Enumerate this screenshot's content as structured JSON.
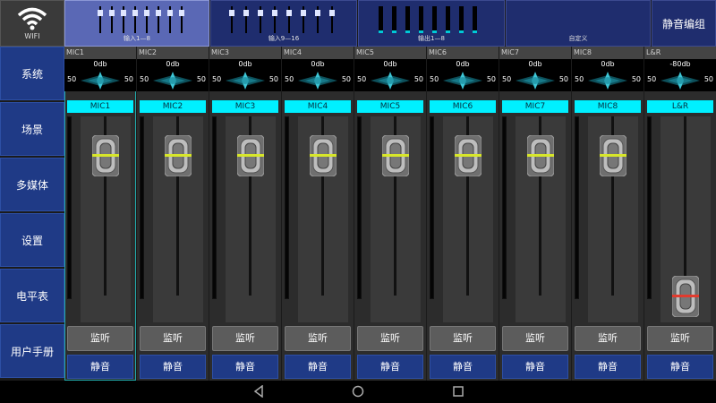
{
  "wifi": {
    "label": "WIFI"
  },
  "tabs": [
    {
      "caption": "输入1—8"
    },
    {
      "caption": "输入9—16"
    },
    {
      "caption": "输出1—8"
    },
    {
      "caption": "自定义"
    }
  ],
  "mute_group": "静音编组",
  "sidebar": [
    {
      "label": "系统"
    },
    {
      "label": "场景"
    },
    {
      "label": "多媒体"
    },
    {
      "label": "设置"
    },
    {
      "label": "电平表"
    },
    {
      "label": "用户手册"
    }
  ],
  "channels": [
    {
      "name": "MIC1",
      "gain": "0db",
      "pan_left": "50",
      "pan_right": "50",
      "tag": "MIC1",
      "monitor": "监听",
      "mute": "静音",
      "fader_level": 0.12,
      "fader_marker": "#d7e62a"
    },
    {
      "name": "MIC2",
      "gain": "0db",
      "pan_left": "50",
      "pan_right": "50",
      "tag": "MIC2",
      "monitor": "监听",
      "mute": "静音",
      "fader_level": 0.12,
      "fader_marker": "#d7e62a"
    },
    {
      "name": "MIC3",
      "gain": "0db",
      "pan_left": "50",
      "pan_right": "50",
      "tag": "MIC3",
      "monitor": "监听",
      "mute": "静音",
      "fader_level": 0.12,
      "fader_marker": "#d7e62a"
    },
    {
      "name": "MIC4",
      "gain": "0db",
      "pan_left": "50",
      "pan_right": "50",
      "tag": "MIC4",
      "monitor": "监听",
      "mute": "静音",
      "fader_level": 0.12,
      "fader_marker": "#d7e62a"
    },
    {
      "name": "MIC5",
      "gain": "0db",
      "pan_left": "50",
      "pan_right": "50",
      "tag": "MIC5",
      "monitor": "监听",
      "mute": "静音",
      "fader_level": 0.12,
      "fader_marker": "#d7e62a"
    },
    {
      "name": "MIC6",
      "gain": "0db",
      "pan_left": "50",
      "pan_right": "50",
      "tag": "MIC6",
      "monitor": "监听",
      "mute": "静音",
      "fader_level": 0.12,
      "fader_marker": "#d7e62a"
    },
    {
      "name": "MIC7",
      "gain": "0db",
      "pan_left": "50",
      "pan_right": "50",
      "tag": "MIC7",
      "monitor": "监听",
      "mute": "静音",
      "fader_level": 0.12,
      "fader_marker": "#d7e62a"
    },
    {
      "name": "MIC8",
      "gain": "0db",
      "pan_left": "50",
      "pan_right": "50",
      "tag": "MIC8",
      "monitor": "监听",
      "mute": "静音",
      "fader_level": 0.12,
      "fader_marker": "#d7e62a"
    },
    {
      "name": "L&R",
      "gain": "-80db",
      "pan_left": "50",
      "pan_right": "50",
      "tag": "L&R",
      "monitor": "监听",
      "mute": "静音",
      "fader_level": 1.0,
      "fader_marker": "#e23b2e"
    }
  ],
  "colors": {
    "accent": "#00f0ff",
    "button_blue": "#1f3a86",
    "active_tab": "#5a68b5"
  },
  "nav_icons": [
    "back-icon",
    "home-icon",
    "recents-icon"
  ]
}
